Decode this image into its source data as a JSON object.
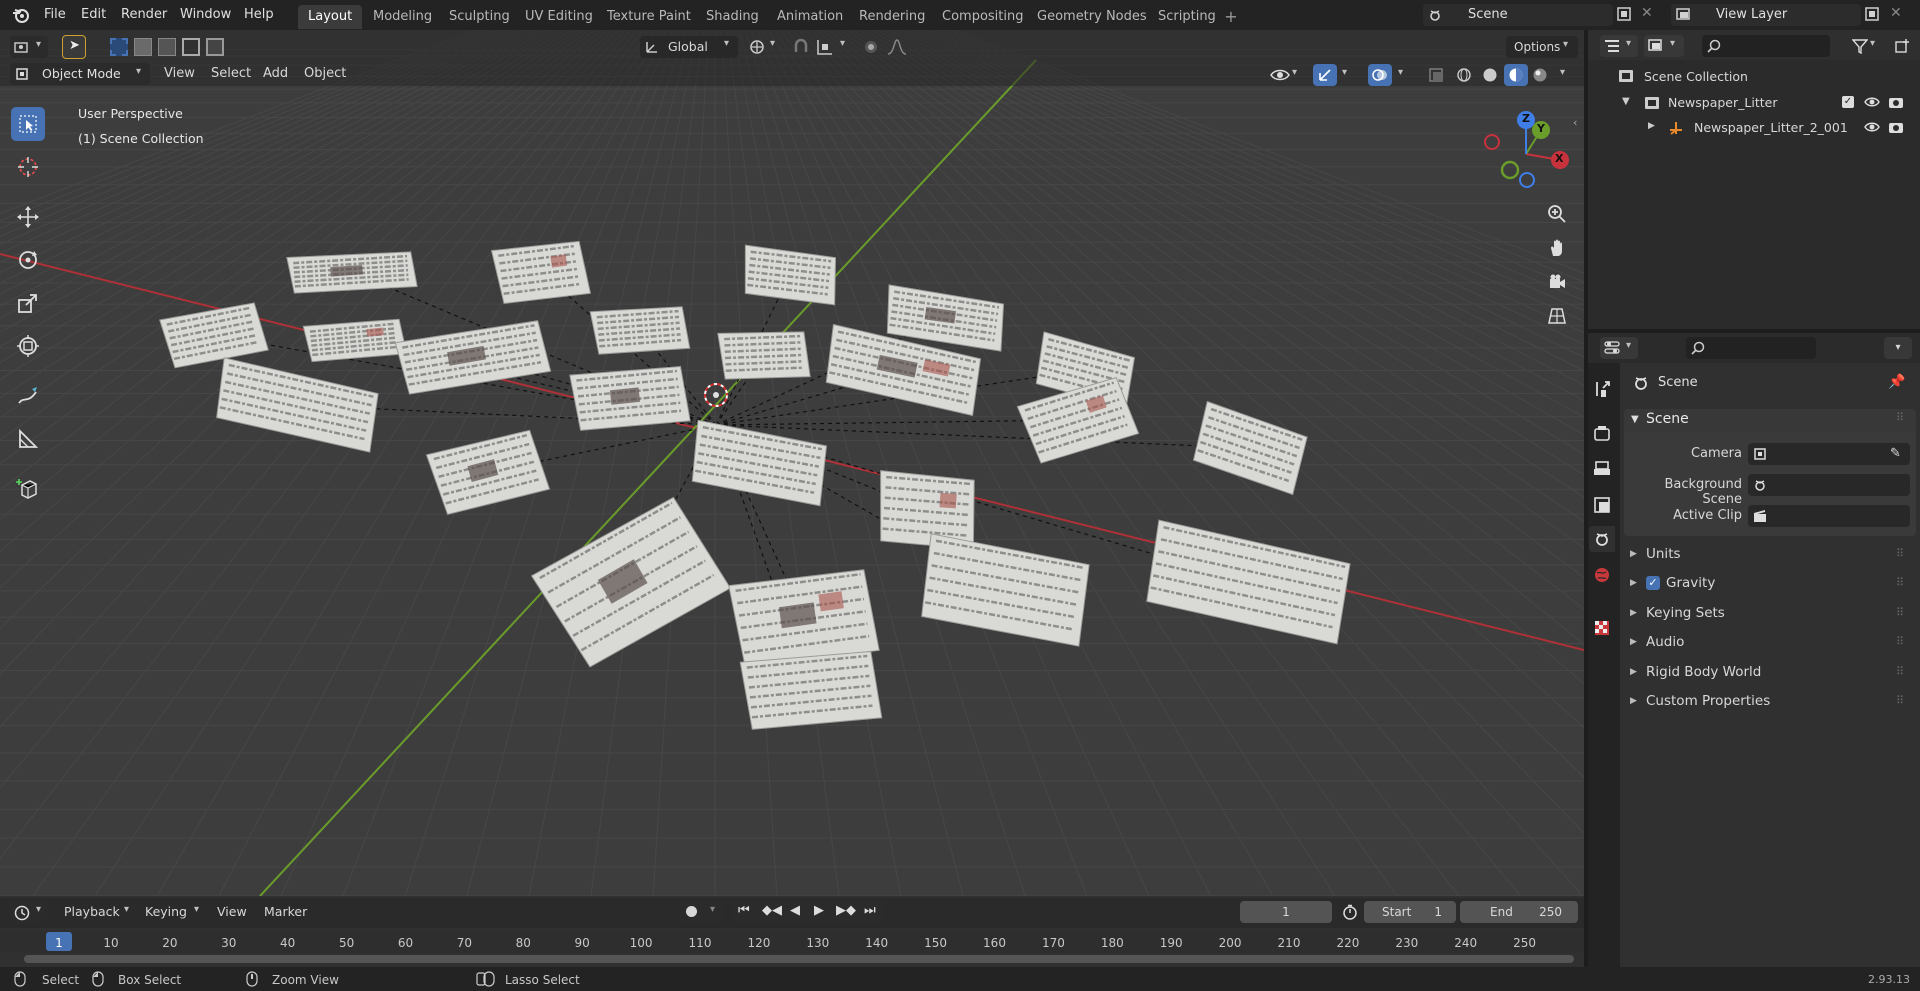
{
  "app": {
    "menus": [
      "File",
      "Edit",
      "Render",
      "Window",
      "Help"
    ],
    "workspace_tabs": [
      "Layout",
      "Modeling",
      "Sculpting",
      "UV Editing",
      "Texture Paint",
      "Shading",
      "Animation",
      "Rendering",
      "Compositing",
      "Geometry Nodes",
      "Scripting"
    ],
    "active_tab": "Layout",
    "scene_name": "Scene",
    "view_layer": "View Layer"
  },
  "viewport": {
    "mode": "Object Mode",
    "menus": [
      "View",
      "Select",
      "Add",
      "Object"
    ],
    "transform_orientation": "Global",
    "options_label": "Options",
    "overlay_line1": "User Perspective",
    "overlay_line2": "(1) Scene Collection",
    "gizmo_axes": {
      "x": "X",
      "y": "Y",
      "z": "Z"
    }
  },
  "outliner": {
    "root": "Scene Collection",
    "collection": "Newspaper_Litter",
    "object": "Newspaper_Litter_2_001"
  },
  "properties": {
    "header": "Scene",
    "panel": "Scene",
    "camera_label": "Camera",
    "background_scene_label": "Background Scene",
    "active_clip_label": "Active Clip",
    "sections": [
      "Units",
      "Gravity",
      "Keying Sets",
      "Audio",
      "Rigid Body World",
      "Custom Properties"
    ],
    "gravity_enabled": true
  },
  "timeline": {
    "menus": [
      "Playback",
      "Keying",
      "View",
      "Marker"
    ],
    "current_frame": "1",
    "start_label": "Start",
    "start": "1",
    "end_label": "End",
    "end": "250",
    "ruler": [
      "1",
      "10",
      "20",
      "30",
      "40",
      "50",
      "60",
      "70",
      "80",
      "90",
      "100",
      "110",
      "120",
      "130",
      "140",
      "150",
      "160",
      "170",
      "180",
      "190",
      "200",
      "210",
      "220",
      "230",
      "240",
      "250"
    ]
  },
  "statusbar": {
    "select": "Select",
    "box_select": "Box Select",
    "zoom_view": "Zoom View",
    "lasso_select": "Lasso Select",
    "version": "2.93.13"
  },
  "colors": {
    "accent": "#4772b3",
    "x_axis": "#c8323c",
    "y_axis": "#6a9d2a",
    "z_axis": "#3f7ee6",
    "viewport_bg": "#3d3d3d"
  }
}
